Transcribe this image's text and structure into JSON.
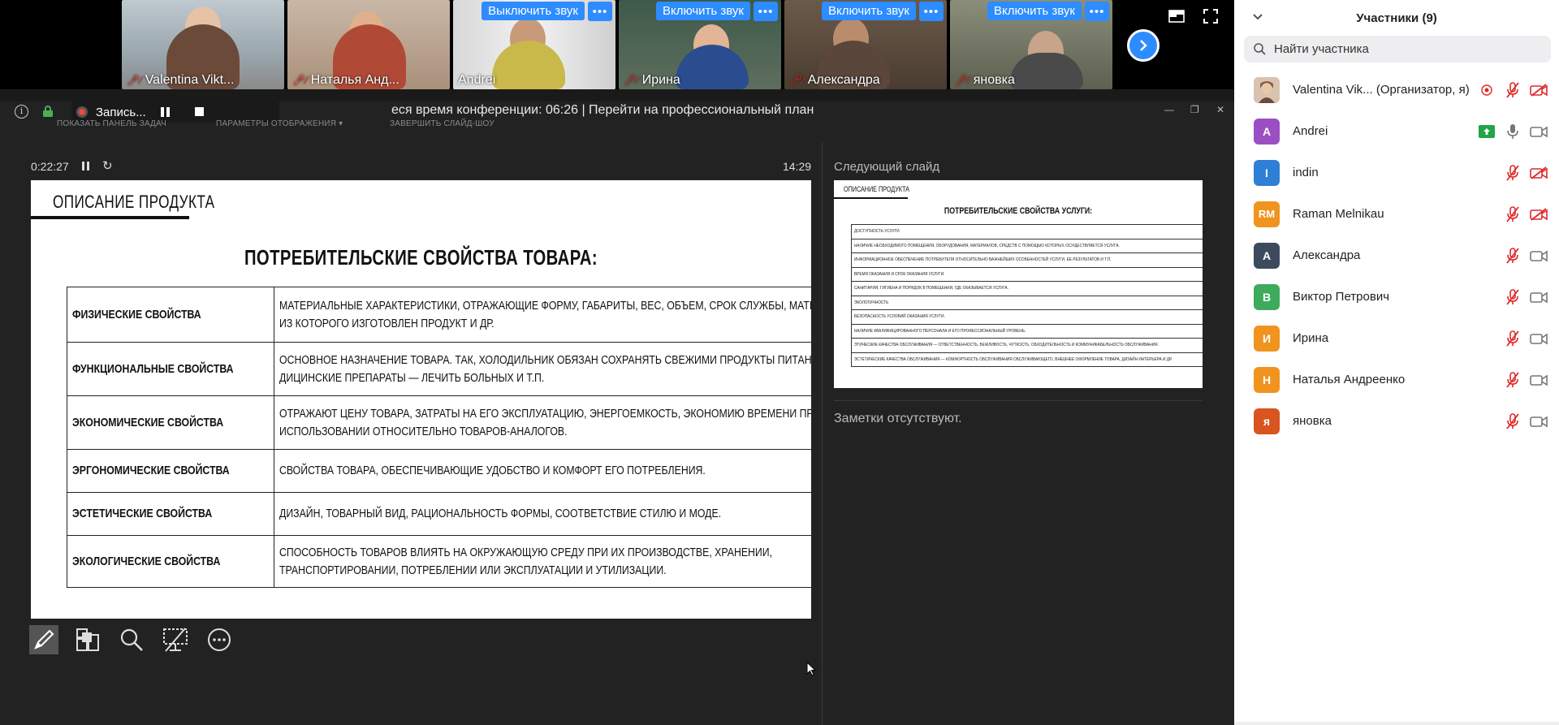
{
  "video_tiles": [
    {
      "name": "Valentina Vikt...",
      "muted": true,
      "show_unmute": false
    },
    {
      "name": "Наталья Анд...",
      "muted": true,
      "show_unmute": false
    },
    {
      "name": "Andrei",
      "muted": false,
      "show_unmute": true,
      "active": true
    },
    {
      "name": "Ирина",
      "muted": true,
      "show_unmute": true
    },
    {
      "name": "Александра",
      "muted": true,
      "show_unmute": true
    },
    {
      "name": "яновка",
      "muted": true,
      "show_unmute": true
    }
  ],
  "unmute_label": "Выключить звук",
  "unmute_label_alt": "Включить звук",
  "more_label": "•••",
  "recording_label": "Запись...",
  "time_left": "еся время конференции: 06:26 | Перейти на профессиональный план",
  "hints": {
    "taskbar": "ПОКАЗАТЬ ПАНЕЛЬ ЗАДАЧ",
    "display": "ПАРАМЕТРЫ ОТОБРАЖЕНИЯ ▾",
    "end_show": "ЗАВЕРШИТЬ СЛАЙД-ШОУ"
  },
  "timer": "0:22:27",
  "clock": "14:29",
  "next_slide_label": "Следующий слайд",
  "notes_text": "Заметки отсутствуют.",
  "slide": {
    "heading": "ОПИСАНИЕ ПРОДУКТА",
    "subtitle": "ПОТРЕБИТЕЛЬСКИЕ СВОЙСТВА ТОВАРА:",
    "rows": [
      {
        "prop": "ФИЗИЧЕСКИЕ СВОЙСТВА",
        "l1": "МАТЕРИАЛЬНЫЕ ХАРАКТЕРИСТИКИ, ОТРАЖАЮЩИЕ ФОРМУ, ГАБАРИТЫ, ВЕС, ОБЪЕМ, СРОК СЛУЖБЫ, МАТЕРИАЛ,",
        "l2": "ИЗ КОТОРОГО ИЗГОТОВЛЕН ПРОДУКТ И ДР."
      },
      {
        "prop": "ФУНКЦИОНАЛЬНЫЕ СВОЙСТВА",
        "l1": "ОСНОВНОЕ НАЗНАЧЕНИЕ ТОВАРА. ТАК, ХОЛОДИЛЬНИК ОБЯЗАН СОХРАНЯТЬ СВЕЖИМИ ПРОДУКТЫ ПИТАНИЯ, МЕ-",
        "l2": "ДИЦИНСКИЕ ПРЕПАРАТЫ — ЛЕЧИТЬ БОЛЬНЫХ И Т.П."
      },
      {
        "prop": "ЭКОНОМИЧЕСКИЕ СВОЙСТВА",
        "l1": "ОТРАЖАЮТ ЦЕНУ ТОВАРА, ЗАТРАТЫ НА ЕГО ЭКСПЛУАТАЦИЮ, ЭНЕРГОЕМКОСТЬ, ЭКОНОМИЮ ВРЕМЕНИ ПРИ",
        "l2": "ИСПОЛЬЗОВАНИИ ОТНОСИТЕЛЬНО ТОВАРОВ-АНАЛОГОВ."
      },
      {
        "prop": "ЭРГОНОМИЧЕСКИЕ СВОЙСТВА",
        "l1": "СВОЙСТВА ТОВАРА, ОБЕСПЕЧИВАЮЩИЕ УДОБСТВО И КОМФОРТ ЕГО ПОТРЕБЛЕНИЯ.",
        "l2": ""
      },
      {
        "prop": "ЭСТЕТИЧЕСКИЕ СВОЙСТВА",
        "l1": "ДИЗАЙН, ТОВАРНЫЙ ВИД, РАЦИОНАЛЬНОСТЬ ФОРМЫ, СООТВЕТСТВИЕ СТИЛЮ И МОДЕ.",
        "l2": ""
      },
      {
        "prop": "ЭКОЛОГИЧЕСКИЕ СВОЙСТВА",
        "l1": "СПОСОБНОСТЬ ТОВАРОВ ВЛИЯТЬ НА ОКРУЖАЮЩУЮ СРЕДУ ПРИ ИХ ПРОИЗВОДСТВЕ, ХРАНЕНИИ,",
        "l2": "ТРАНСПОРТИРОВАНИИ, ПОТРЕБЛЕНИИ ИЛИ ЭКСПЛУАТАЦИИ И УТИЛИЗАЦИИ."
      }
    ]
  },
  "next_slide": {
    "heading": "ОПИСАНИЕ ПРОДУКТА",
    "subtitle": "ПОТРЕБИТЕЛЬСКИЕ СВОЙСТВА УСЛУГИ:",
    "rows": [
      "ДОСТУПНОСТЬ УСЛУГИ",
      "НАЛИЧИЕ НЕОБХОДИМОГО ПОМЕЩЕНИЯ, ОБОРУДОВАНИЯ, МАТЕРИАЛОВ, СРЕДСТВ С ПОМОЩЬЮ КОТОРЫХ ОСУЩЕСТВЛЯЕТСЯ УСЛУГА.",
      "ИНФОРМАЦИОННОЕ ОБЕСПЕЧЕНИЕ ПОТРЕБИТЕЛЯ ОТНОСИТЕЛЬНО ВАЖНЕЙШИХ ОСОБЕННОСТЕЙ УСЛУГИ, ЕЕ РЕЗУЛЬТАТОВ И Т.П.",
      "ВРЕМЯ ОКАЗАНИЯ И СРОК ОКАЗАНИЯ УСЛУГИ.",
      "САНИТАРИЯ, ГИГИЕНА И ПОРЯДОК В ПОМЕЩЕНИИ, ГДЕ ОКАЗЫВАЕТСЯ УСЛУГА.",
      "ЭКОЛОГИЧНОСТЬ",
      "БЕЗОПАСНОСТЬ УСЛОВИЙ ОКАЗАНИЯ УСЛУГИ.",
      "НАЛИЧИЕ КВАЛИФИЦИРОВАННОГО ПЕРСОНАЛА И ЕГО ПРОФЕССИОНАЛЬНЫЙ УРОВЕНЬ.",
      "ЭТИЧЕСКИЕ КАЧЕСТВА ОБСЛУЖИВАНИЯ — ОТВЕТСТВЕННОСТЬ, ВЕЖЛИВОСТЬ, ЧУТКОСТЬ, ОБХОДИТЕЛЬНОСТЬ И КОММУНИКАБЕЛЬНОСТЬ ОБСЛУЖИВАНИЯ.",
      "ЭСТЕТИЧЕСКИЕ КАЧЕСТВА ОБСЛУЖИВАНИЯ — КОМФОРТНОСТЬ ОБСЛУЖИВАНИЯ ОБСЛУЖИВАЮЩЕГО, ВНЕШНЕЕ ОФОРМЛЕНИЕ ТОВАРА, ДИЗАЙН ИНТЕРЬЕРА И ДР."
    ]
  },
  "participants_panel": {
    "title": "Участники (9)",
    "search_placeholder": "Найти участника",
    "participants": [
      {
        "name": "Valentina Vik... (Организатор, я)",
        "avatar": "",
        "color": "#c8a48a",
        "mic": "muted",
        "video": "off",
        "rec": true
      },
      {
        "name": "Andrei",
        "avatar": "A",
        "color": "#9b4fc3",
        "mic": "on",
        "video": "on",
        "share": true
      },
      {
        "name": "indin",
        "avatar": "I",
        "color": "#2f7fd6",
        "mic": "muted",
        "video": "off"
      },
      {
        "name": "Raman Melnikau",
        "avatar": "RM",
        "color": "#f0941f",
        "mic": "muted",
        "video": "off"
      },
      {
        "name": "Александра",
        "avatar": "А",
        "color": "#3c4a5e",
        "mic": "muted",
        "video": "on"
      },
      {
        "name": "Виктор Петрович",
        "avatar": "В",
        "color": "#3eaa5c",
        "mic": "muted",
        "video": "on"
      },
      {
        "name": "Ирина",
        "avatar": "И",
        "color": "#f0941f",
        "mic": "muted",
        "video": "on"
      },
      {
        "name": "Наталья Андреенко",
        "avatar": "Н",
        "color": "#f0941f",
        "mic": "muted",
        "video": "on"
      },
      {
        "name": "яновка",
        "avatar": "я",
        "color": "#d9541f",
        "mic": "muted",
        "video": "on"
      }
    ]
  }
}
